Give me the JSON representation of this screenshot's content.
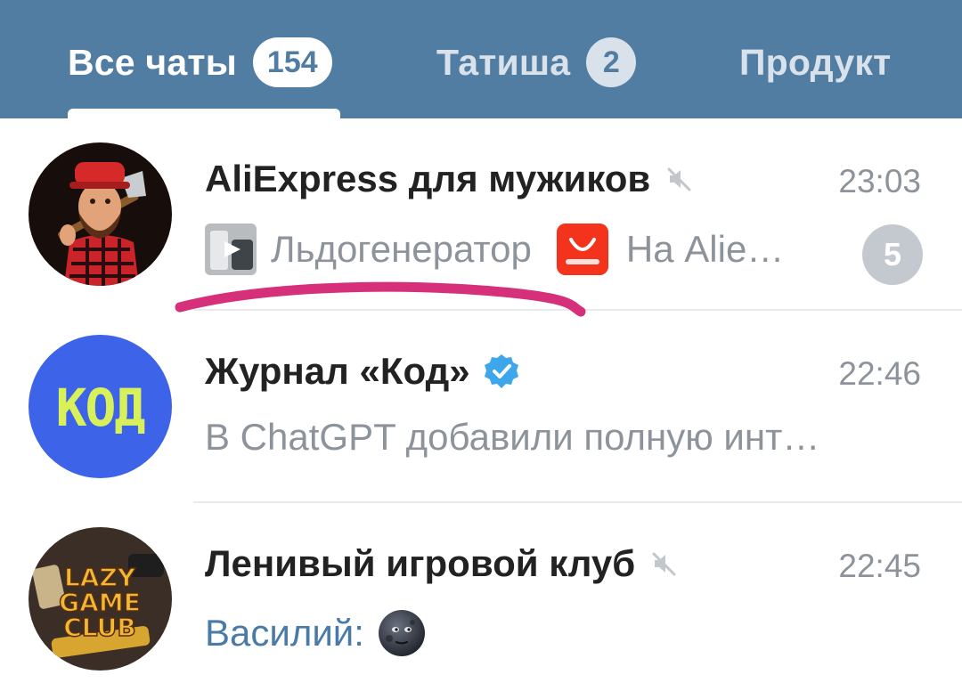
{
  "tabs": [
    {
      "label": "Все чаты",
      "badge": "154",
      "active": true
    },
    {
      "label": "Татиша",
      "badge": "2",
      "active": false
    },
    {
      "label": "Продукт",
      "badge": "",
      "active": false
    }
  ],
  "chats": [
    {
      "title": "AliExpress для мужиков",
      "muted": true,
      "time": "23:03",
      "preview_parts": [
        "Льдогенератор",
        "На Alie…"
      ],
      "unread": "5",
      "avatar_icon": "lumberjack-avatar"
    },
    {
      "title": "Журнал «Код»",
      "verified": true,
      "time": "22:46",
      "preview": "В ChatGPT добавили полную инт…",
      "avatar_icon": "kod-logo-avatar",
      "avatar_text": "КОД"
    },
    {
      "title": "Ленивый игровой клуб",
      "muted": true,
      "time": "22:45",
      "preview_sender": "Василий:",
      "preview_emoji": "new-moon-face-emoji",
      "avatar_icon": "lazy-game-club-avatar",
      "avatar_text": [
        "LAZY",
        "GAME",
        "CLUB"
      ]
    }
  ],
  "colors": {
    "header_bg": "#527da3",
    "muted_text": "#8c939a",
    "sender_text": "#4a7ba8",
    "annotation_marker": "#d6307a"
  }
}
